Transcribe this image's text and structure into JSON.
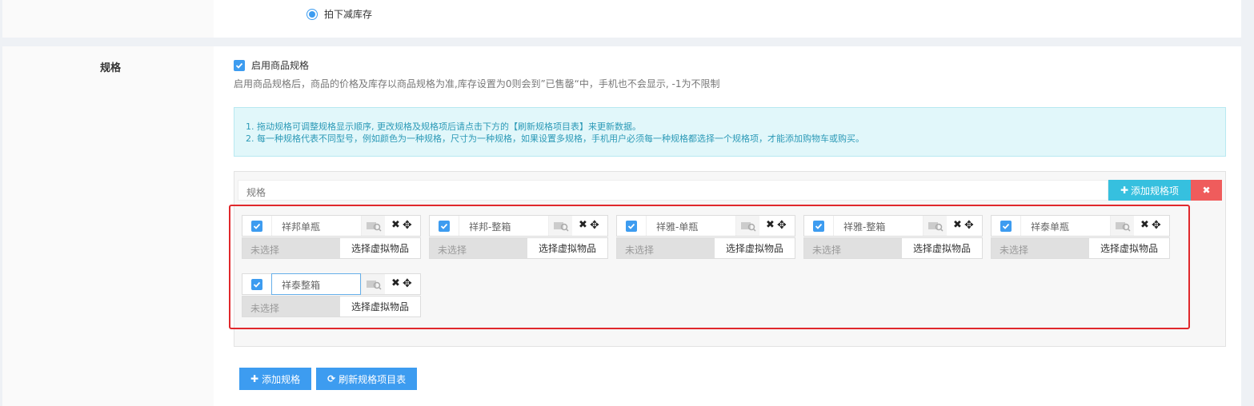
{
  "inventory": {
    "option_label": "拍下减库存"
  },
  "spec": {
    "field_label": "规格",
    "enable_label": "启用商品规格",
    "help_text": "启用商品规格后，商品的价格及库存以商品规格为准,库存设置为0则会到”已售罄“中，手机也不会显示, -1为不限制",
    "alert_lines": [
      "1. 拖动规格可调整规格显示顺序, 更改规格及规格项后请点击下方的【刷新规格项目表】来更新数据。",
      "2. 每一种规格代表不同型号，例如颜色为一种规格，尺寸为一种规格，如果设置多规格，手机用户必须每一种规格都选择一个规格项，才能添加购物车或购买。"
    ],
    "title_placeholder": "规格",
    "add_item_label": "添加规格项",
    "delete_icon": "close-icon",
    "items": [
      {
        "name": "祥邦单瓶",
        "unselected": "未选择",
        "choose_label": "选择虚拟物品"
      },
      {
        "name": "祥邦-整箱",
        "unselected": "未选择",
        "choose_label": "选择虚拟物品"
      },
      {
        "name": "祥雅-单瓶",
        "unselected": "未选择",
        "choose_label": "选择虚拟物品"
      },
      {
        "name": "祥雅-整箱",
        "unselected": "未选择",
        "choose_label": "选择虚拟物品"
      },
      {
        "name": "祥泰单瓶",
        "unselected": "未选择",
        "choose_label": "选择虚拟物品"
      },
      {
        "name": "祥泰整箱",
        "unselected": "未选择",
        "choose_label": "选择虚拟物品"
      }
    ]
  },
  "actions": {
    "add_spec_label": "添加规格",
    "refresh_label": "刷新规格项目表"
  },
  "colors": {
    "primary": "#3d9cf0",
    "info": "#36c0df",
    "danger": "#ef5c5c",
    "highlight": "#e0282c"
  }
}
